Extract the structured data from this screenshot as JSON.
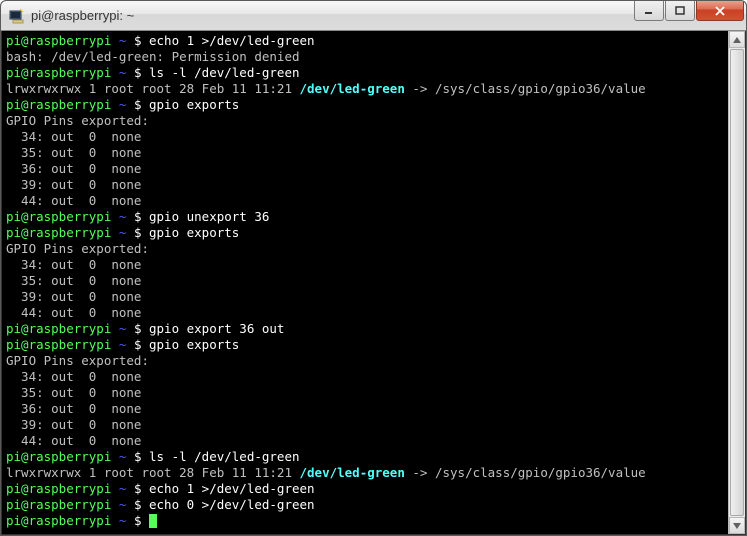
{
  "title": "pi@raspberrypi: ~",
  "prompt": {
    "user": "pi@raspberrypi",
    "sep": " ~ $ ",
    "tilde": "~",
    "dollar": " $ "
  },
  "lines": [
    {
      "type": "cmd",
      "cmd": "echo 1 >/dev/led-green"
    },
    {
      "type": "out",
      "text": "bash: /dev/led-green: Permission denied"
    },
    {
      "type": "cmd",
      "cmd": "ls -l /dev/led-green"
    },
    {
      "type": "ls",
      "pre": "lrwxrwxrwx 1 root root 28 Feb 11 11:21 ",
      "link": "/dev/led-green",
      "post": " -> /sys/class/gpio/gpio36/value"
    },
    {
      "type": "cmd",
      "cmd": "gpio exports"
    },
    {
      "type": "out",
      "text": "GPIO Pins exported:"
    },
    {
      "type": "out",
      "text": "  34: out  0  none"
    },
    {
      "type": "out",
      "text": "  35: out  0  none"
    },
    {
      "type": "out",
      "text": "  36: out  0  none"
    },
    {
      "type": "out",
      "text": "  39: out  0  none"
    },
    {
      "type": "out",
      "text": "  44: out  0  none"
    },
    {
      "type": "cmd",
      "cmd": "gpio unexport 36"
    },
    {
      "type": "cmd",
      "cmd": "gpio exports"
    },
    {
      "type": "out",
      "text": "GPIO Pins exported:"
    },
    {
      "type": "out",
      "text": "  34: out  0  none"
    },
    {
      "type": "out",
      "text": "  35: out  0  none"
    },
    {
      "type": "out",
      "text": "  39: out  0  none"
    },
    {
      "type": "out",
      "text": "  44: out  0  none"
    },
    {
      "type": "cmd",
      "cmd": "gpio export 36 out"
    },
    {
      "type": "cmd",
      "cmd": "gpio exports"
    },
    {
      "type": "out",
      "text": "GPIO Pins exported:"
    },
    {
      "type": "out",
      "text": "  34: out  0  none"
    },
    {
      "type": "out",
      "text": "  35: out  0  none"
    },
    {
      "type": "out",
      "text": "  36: out  0  none"
    },
    {
      "type": "out",
      "text": "  39: out  0  none"
    },
    {
      "type": "out",
      "text": "  44: out  0  none"
    },
    {
      "type": "cmd",
      "cmd": "ls -l /dev/led-green"
    },
    {
      "type": "ls",
      "pre": "lrwxrwxrwx 1 root root 28 Feb 11 11:21 ",
      "link": "/dev/led-green",
      "post": " -> /sys/class/gpio/gpio36/value"
    },
    {
      "type": "cmd",
      "cmd": "echo 1 >/dev/led-green"
    },
    {
      "type": "cmd",
      "cmd": "echo 0 >/dev/led-green"
    },
    {
      "type": "cmd-cursor",
      "cmd": ""
    }
  ]
}
